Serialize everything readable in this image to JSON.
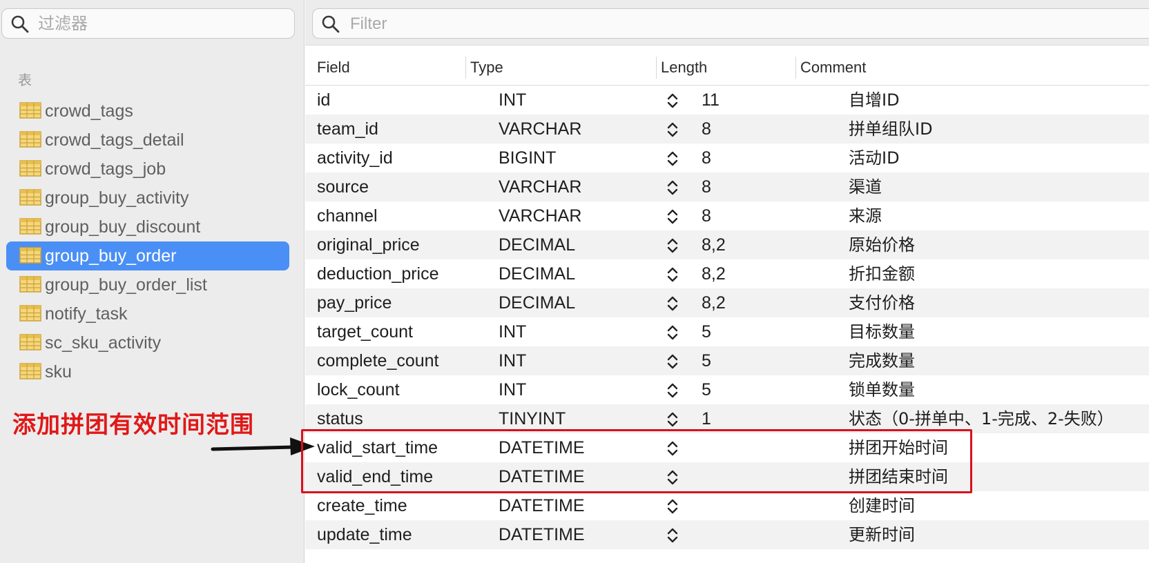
{
  "sidebar": {
    "filter_placeholder": "过滤器",
    "section_label": "表",
    "tables": [
      {
        "name": "crowd_tags",
        "selected": false
      },
      {
        "name": "crowd_tags_detail",
        "selected": false
      },
      {
        "name": "crowd_tags_job",
        "selected": false
      },
      {
        "name": "group_buy_activity",
        "selected": false
      },
      {
        "name": "group_buy_discount",
        "selected": false
      },
      {
        "name": "group_buy_order",
        "selected": true
      },
      {
        "name": "group_buy_order_list",
        "selected": false
      },
      {
        "name": "notify_task",
        "selected": false
      },
      {
        "name": "sc_sku_activity",
        "selected": false
      },
      {
        "name": "sku",
        "selected": false
      }
    ]
  },
  "main": {
    "filter_placeholder": "Filter",
    "columns": [
      "Field",
      "Type",
      "Length",
      "Comment"
    ],
    "rows": [
      {
        "field": "id",
        "type": "INT",
        "length": "11",
        "comment": "自增ID"
      },
      {
        "field": "team_id",
        "type": "VARCHAR",
        "length": "8",
        "comment": "拼单组队ID"
      },
      {
        "field": "activity_id",
        "type": "BIGINT",
        "length": "8",
        "comment": "活动ID"
      },
      {
        "field": "source",
        "type": "VARCHAR",
        "length": "8",
        "comment": "渠道"
      },
      {
        "field": "channel",
        "type": "VARCHAR",
        "length": "8",
        "comment": "来源"
      },
      {
        "field": "original_price",
        "type": "DECIMAL",
        "length": "8,2",
        "comment": "原始价格"
      },
      {
        "field": "deduction_price",
        "type": "DECIMAL",
        "length": "8,2",
        "comment": "折扣金额"
      },
      {
        "field": "pay_price",
        "type": "DECIMAL",
        "length": "8,2",
        "comment": "支付价格"
      },
      {
        "field": "target_count",
        "type": "INT",
        "length": "5",
        "comment": "目标数量"
      },
      {
        "field": "complete_count",
        "type": "INT",
        "length": "5",
        "comment": "完成数量"
      },
      {
        "field": "lock_count",
        "type": "INT",
        "length": "5",
        "comment": "锁单数量"
      },
      {
        "field": "status",
        "type": "TINYINT",
        "length": "1",
        "comment": "状态（0-拼单中、1-完成、2-失败）"
      },
      {
        "field": "valid_start_time",
        "type": "DATETIME",
        "length": "",
        "comment": "拼团开始时间"
      },
      {
        "field": "valid_end_time",
        "type": "DATETIME",
        "length": "",
        "comment": "拼团结束时间"
      },
      {
        "field": "create_time",
        "type": "DATETIME",
        "length": "",
        "comment": "创建时间"
      },
      {
        "field": "update_time",
        "type": "DATETIME",
        "length": "",
        "comment": "更新时间"
      }
    ]
  },
  "annotation": {
    "text": "添加拼团有效时间范围",
    "color": "#e01818"
  },
  "colors": {
    "selection": "#4a8ff5",
    "sidebar_bg": "#ececec",
    "annotation_red": "#d8101f"
  }
}
